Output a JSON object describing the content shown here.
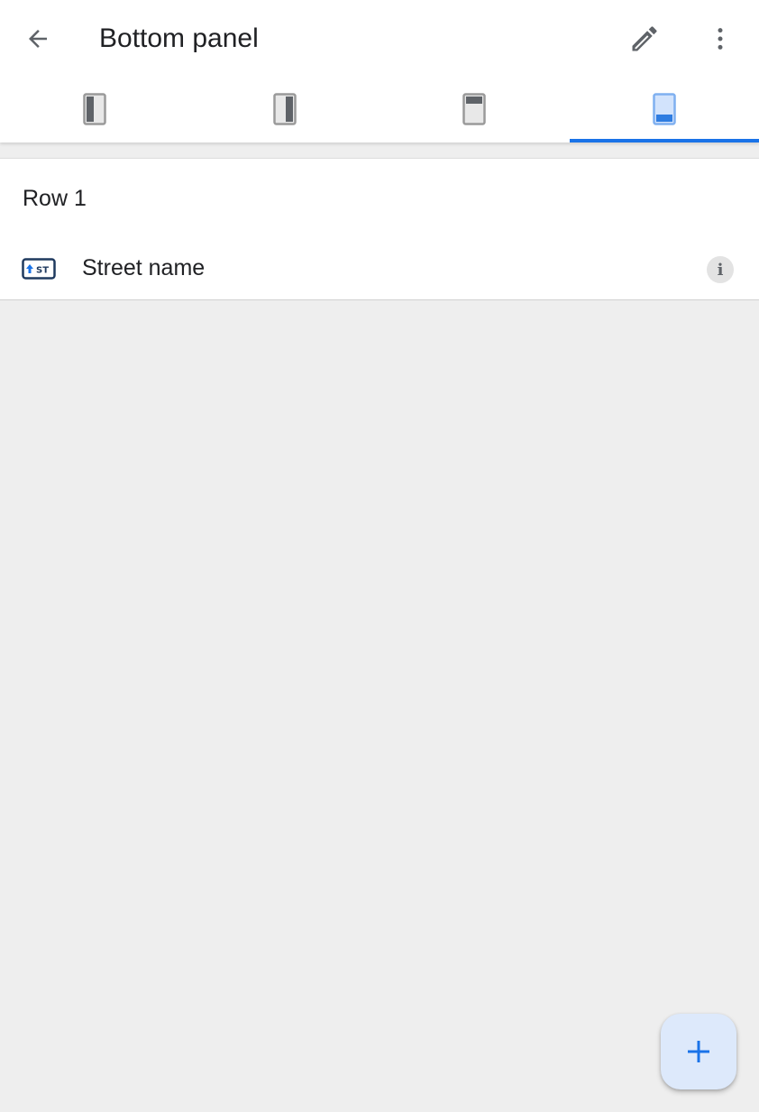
{
  "app_bar": {
    "title": "Bottom panel",
    "back_icon": "arrow-back-icon",
    "edit_icon": "pencil-icon",
    "more_icon": "more-vert-icon"
  },
  "tabs": [
    {
      "icon": "left-panel-layout-icon",
      "selected": false
    },
    {
      "icon": "right-panel-layout-icon",
      "selected": false
    },
    {
      "icon": "top-panel-layout-icon",
      "selected": false
    },
    {
      "icon": "bottom-panel-layout-icon",
      "selected": true
    }
  ],
  "section": {
    "row_label": "Row 1",
    "items": [
      {
        "label": "Street name",
        "icon": "street-name-icon",
        "icon_text": "ST",
        "info_icon": "info-icon"
      }
    ]
  },
  "fab": {
    "icon": "plus-icon"
  },
  "colors": {
    "accent": "#1a73e8",
    "selected_tab_icon": "#2f7de1",
    "icon_gray": "#5f6368",
    "background": "#eeeeee",
    "fab_background": "#dde9fb"
  }
}
